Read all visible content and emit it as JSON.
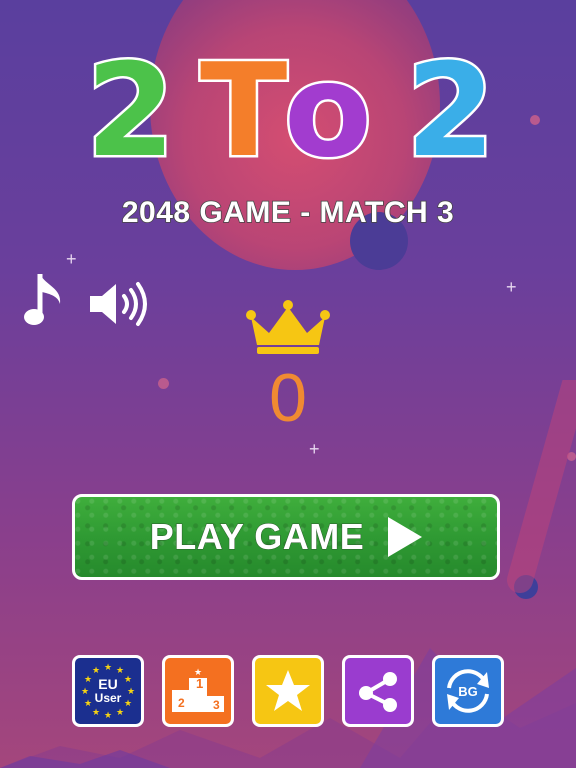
{
  "title": {
    "letters": [
      "2",
      "T",
      "o",
      "2"
    ]
  },
  "subtitle": "2048 GAME - MATCH 3",
  "score": "0",
  "play_button": {
    "label": "PLAY GAME"
  },
  "eu_button": {
    "line1": "EU",
    "line2": "User"
  },
  "leaderboard_button": {
    "first": "1",
    "second": "2",
    "third": "3"
  },
  "bg_button": {
    "label": "BG"
  },
  "colors": {
    "title_green": "#4cc24a",
    "title_orange": "#f47e2a",
    "title_purple": "#a23ccf",
    "title_blue": "#3aaee8",
    "score": "#f08a32",
    "play_green": "#2f9a33",
    "eu_blue": "#1b2f8f",
    "leaderboard_orange": "#f47020",
    "star_yellow": "#f6c613",
    "share_purple": "#9a3ccf",
    "bg_blue": "#2e7ad8"
  },
  "icons": [
    "music-note-icon",
    "speaker-icon",
    "crown-icon",
    "play-triangle-icon",
    "eu-stars-icon",
    "podium-icon",
    "star-icon",
    "share-icon",
    "refresh-arrows-icon"
  ]
}
